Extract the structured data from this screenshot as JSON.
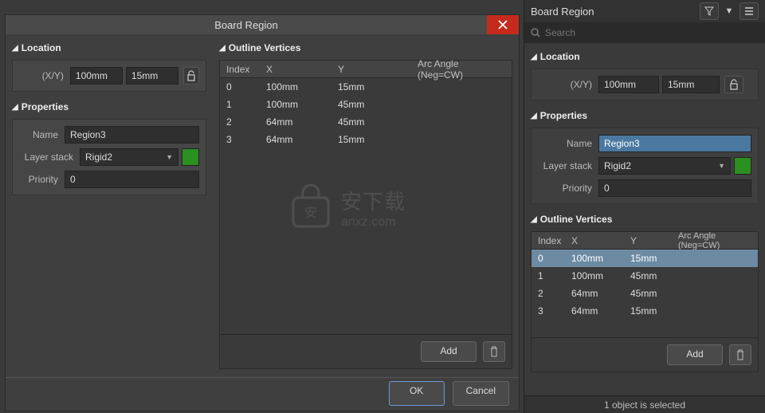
{
  "dialog": {
    "title": "Board Region",
    "location": {
      "header": "Location",
      "xy_label": "(X/Y)",
      "x": "100mm",
      "y": "15mm"
    },
    "properties": {
      "header": "Properties",
      "name_label": "Name",
      "name": "Region3",
      "layer_stack_label": "Layer stack",
      "layer_stack": "Rigid2",
      "priority_label": "Priority",
      "priority": "0"
    },
    "outline": {
      "header": "Outline Vertices",
      "cols": {
        "index": "Index",
        "x": "X",
        "y": "Y",
        "arc": "Arc Angle (Neg=CW)"
      },
      "rows": [
        {
          "i": "0",
          "x": "100mm",
          "y": "15mm",
          "arc": ""
        },
        {
          "i": "1",
          "x": "100mm",
          "y": "45mm",
          "arc": ""
        },
        {
          "i": "2",
          "x": "64mm",
          "y": "45mm",
          "arc": ""
        },
        {
          "i": "3",
          "x": "64mm",
          "y": "15mm",
          "arc": ""
        }
      ],
      "add_label": "Add"
    },
    "ok": "OK",
    "cancel": "Cancel"
  },
  "panel": {
    "title": "Board Region",
    "search_placeholder": "Search",
    "location": {
      "header": "Location",
      "xy_label": "(X/Y)",
      "x": "100mm",
      "y": "15mm"
    },
    "properties": {
      "header": "Properties",
      "name_label": "Name",
      "name": "Region3",
      "layer_stack_label": "Layer stack",
      "layer_stack": "Rigid2",
      "priority_label": "Priority",
      "priority": "0"
    },
    "outline": {
      "header": "Outline Vertices",
      "cols": {
        "index": "Index",
        "x": "X",
        "y": "Y",
        "arc": "Arc Angle (Neg=CW)"
      },
      "rows": [
        {
          "i": "0",
          "x": "100mm",
          "y": "15mm",
          "arc": ""
        },
        {
          "i": "1",
          "x": "100mm",
          "y": "45mm",
          "arc": ""
        },
        {
          "i": "2",
          "x": "64mm",
          "y": "45mm",
          "arc": ""
        },
        {
          "i": "3",
          "x": "64mm",
          "y": "15mm",
          "arc": ""
        }
      ],
      "add_label": "Add"
    },
    "status": "1 object is selected"
  },
  "watermark": {
    "main": "安下载",
    "sub": "anxz.com"
  }
}
